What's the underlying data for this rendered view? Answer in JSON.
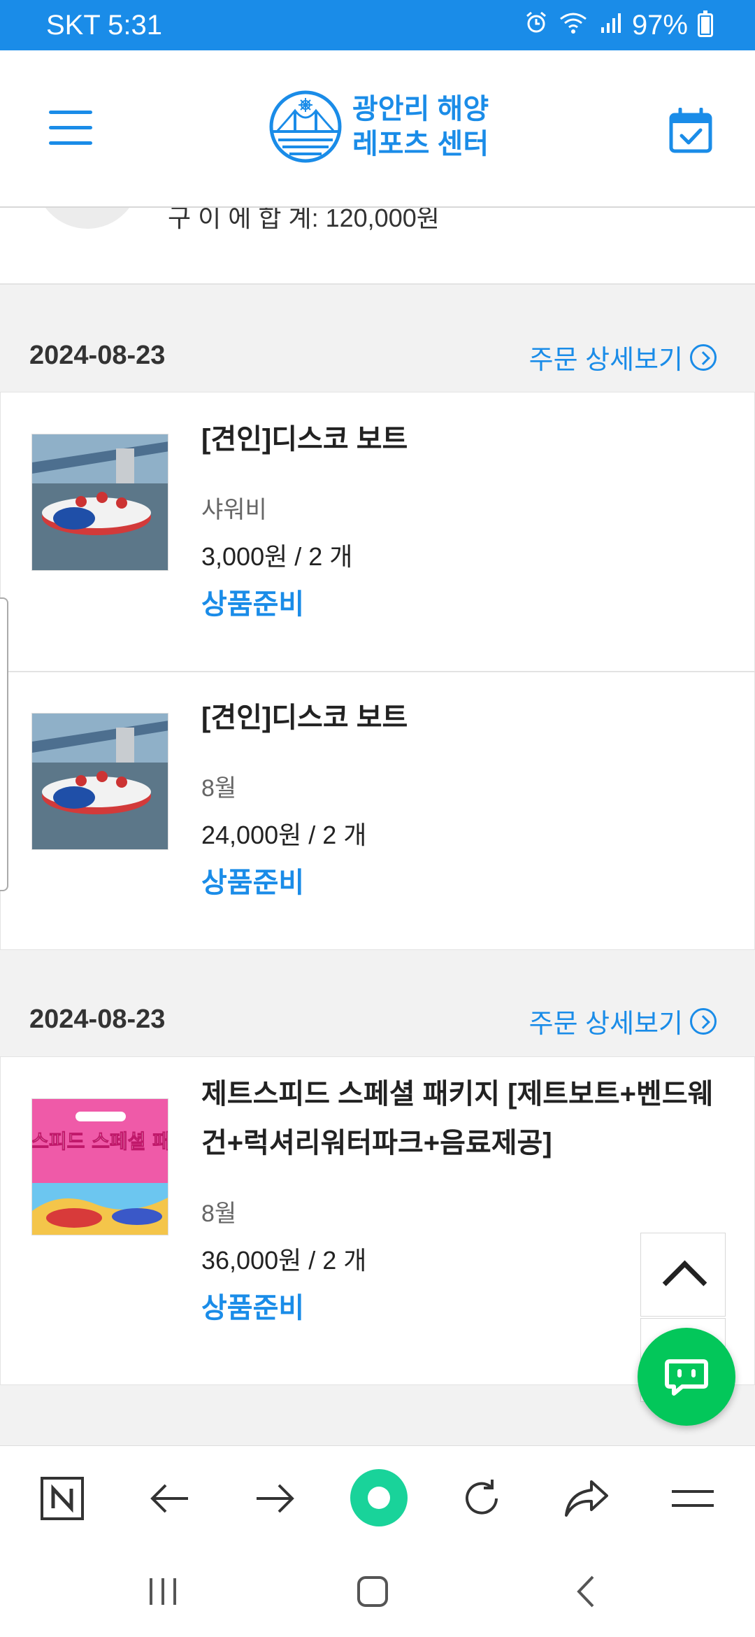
{
  "status_bar": {
    "carrier_time": "SKT 5:31",
    "battery": "97%"
  },
  "header": {
    "logo_line1": "광안리 해양",
    "logo_line2": "레포츠 센터"
  },
  "partial": {
    "text": "구 이 에 합 계: 120,000원"
  },
  "groups": [
    {
      "date": "2024-08-23",
      "detail_label": "주문 상세보기",
      "items": [
        {
          "name": "[견인]디스코 보트",
          "option": "샤워비",
          "price": "3,000원 / 2 개",
          "status": "상품준비"
        },
        {
          "name": "[견인]디스코 보트",
          "option": "8월",
          "price": "24,000원 / 2 개",
          "status": "상품준비"
        }
      ]
    },
    {
      "date": "2024-08-23",
      "detail_label": "주문 상세보기",
      "items": [
        {
          "name": "제트스피드 스페셜 패키지 [제트보트+벤드웨건+럭셔리워터파크+음료제공]",
          "option": "8월",
          "price": "36,000원 / 2 개",
          "status": "상품준비",
          "thumb_title": "제트스피드 스페셜 패키지"
        }
      ]
    }
  ],
  "colors": {
    "accent": "#1a8ce8",
    "chat_green": "#03c75a"
  }
}
